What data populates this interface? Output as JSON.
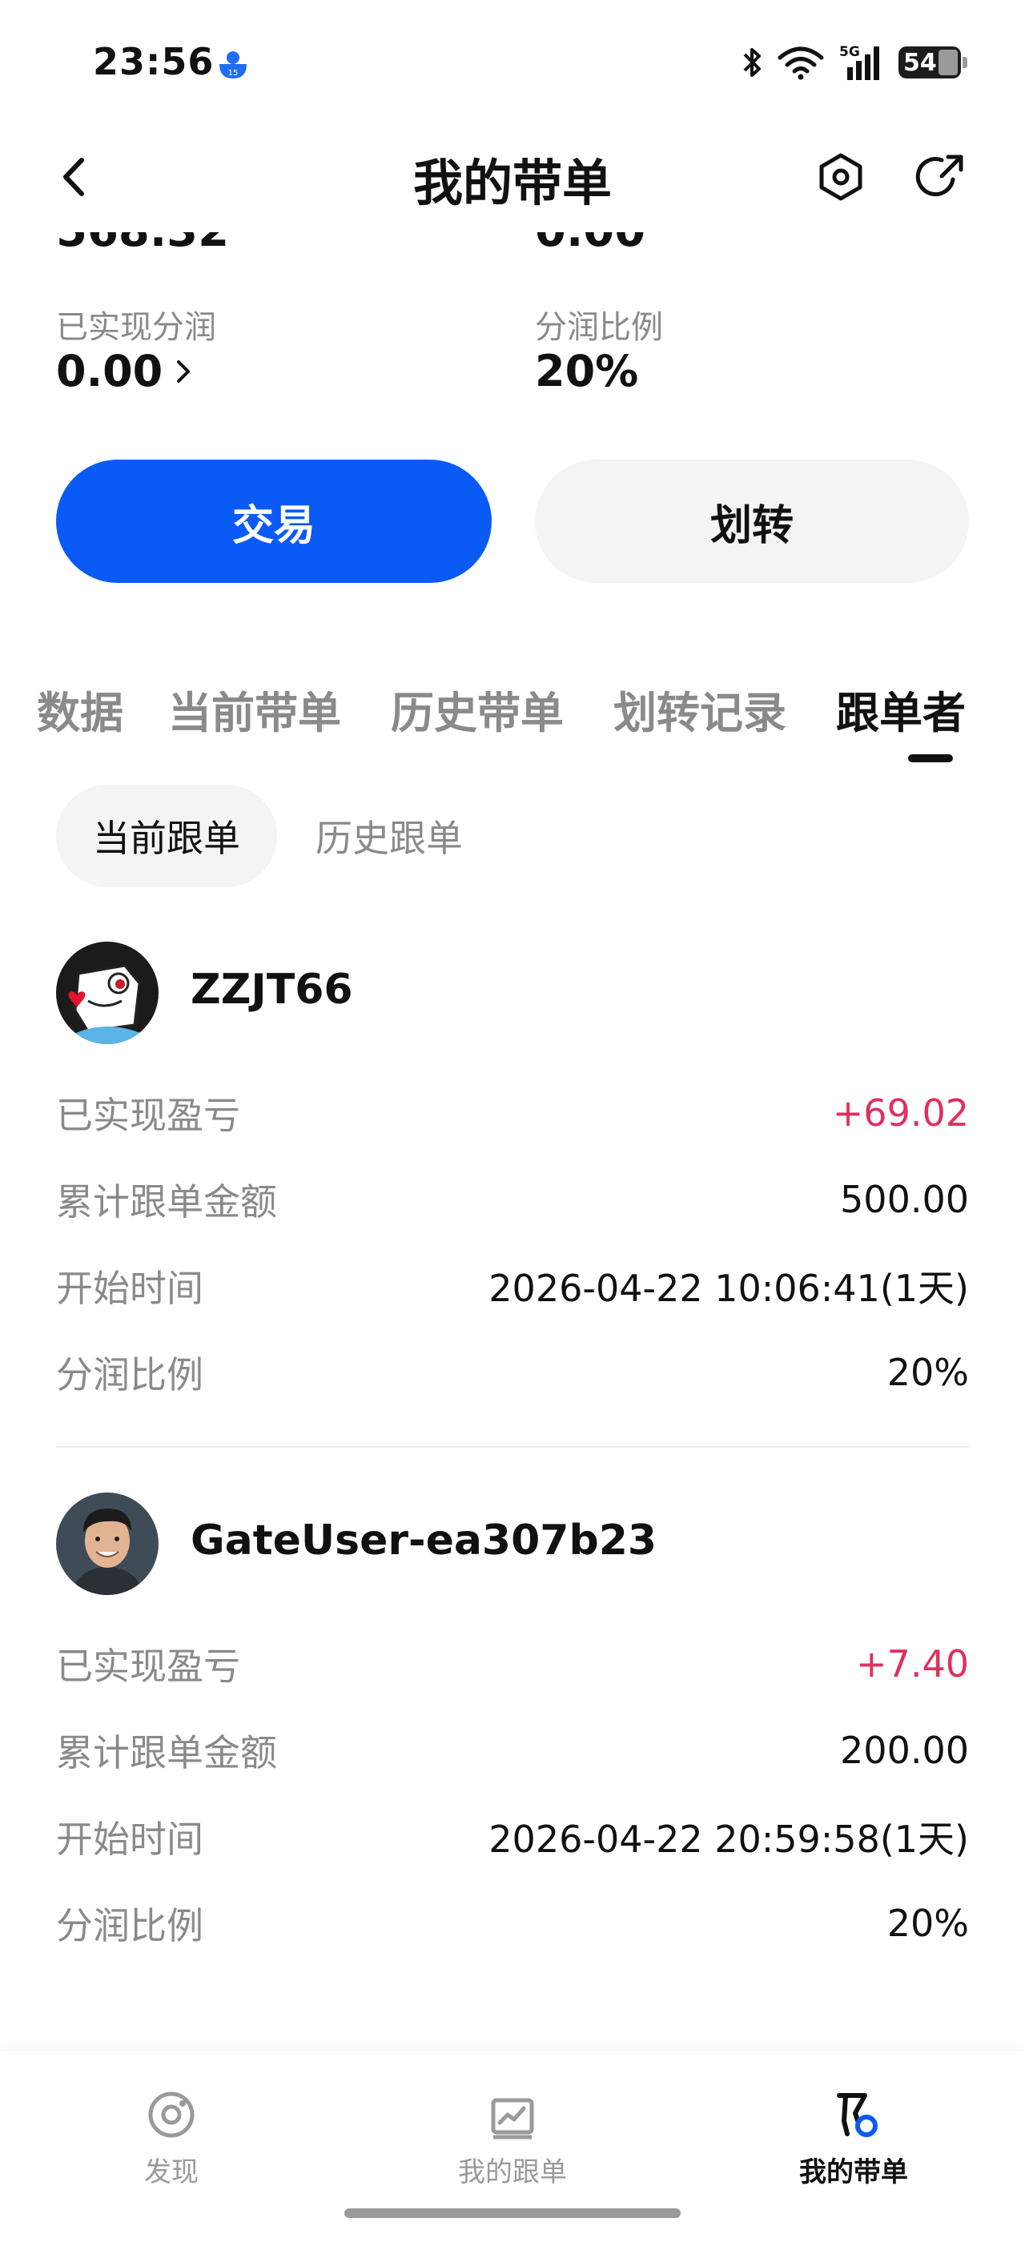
{
  "status_bar": {
    "time": "23:56",
    "network": "5G",
    "battery": "54"
  },
  "nav": {
    "title": "我的带单"
  },
  "summary": {
    "cut_left_value": "568.32",
    "cut_right_value": "0.00",
    "realized_share_label": "已实现分润",
    "realized_share_value": "0.00",
    "share_ratio_label": "分润比例",
    "share_ratio_value": "20%"
  },
  "actions": {
    "trade_label": "交易",
    "transfer_label": "划转"
  },
  "tabs": [
    {
      "label": "数据"
    },
    {
      "label": "当前带单"
    },
    {
      "label": "历史带单"
    },
    {
      "label": "划转记录"
    },
    {
      "label": "跟单者"
    }
  ],
  "subtabs": {
    "current": "当前跟单",
    "history": "历史跟单"
  },
  "followers": [
    {
      "name": "ZZJT66",
      "rows": [
        {
          "label": "已实现盈亏",
          "value": "+69.02"
        },
        {
          "label": "累计跟单金额",
          "value": "500.00"
        },
        {
          "label": "开始时间",
          "value": "2026-04-22 10:06:41(1天)"
        },
        {
          "label": "分润比例",
          "value": "20%"
        }
      ]
    },
    {
      "name": "GateUser-ea307b23",
      "rows": [
        {
          "label": "已实现盈亏",
          "value": "+7.40"
        },
        {
          "label": "累计跟单金额",
          "value": "200.00"
        },
        {
          "label": "开始时间",
          "value": "2026-04-22 20:59:58(1天)"
        },
        {
          "label": "分润比例",
          "value": "20%"
        }
      ]
    }
  ],
  "bottom_nav": [
    {
      "label": "发现",
      "icon": "discover-icon"
    },
    {
      "label": "我的跟单",
      "icon": "chart-icon"
    },
    {
      "label": "我的带单",
      "icon": "lead-trade-icon"
    }
  ],
  "colors": {
    "accent": "#0a5bf6",
    "profit": "#e0305e",
    "muted": "#8a8a8a"
  }
}
